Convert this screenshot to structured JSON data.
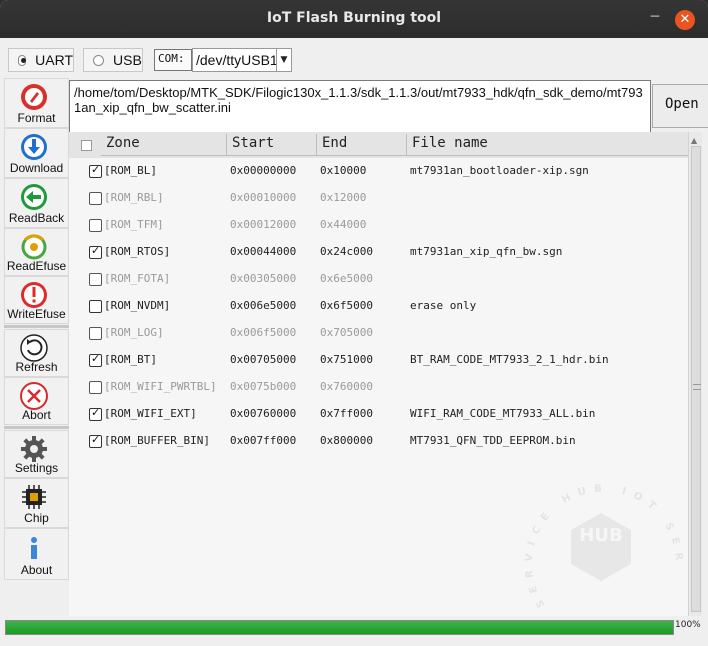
{
  "window": {
    "title": "IoT Flash Burning tool"
  },
  "connection": {
    "uart_label": "UART",
    "usb_label": "USB",
    "selected": "UART",
    "com_label": "COM:",
    "com_value": "/dev/ttyUSB1"
  },
  "sidebar": {
    "items": [
      {
        "label": "Format",
        "icon": "format-icon"
      },
      {
        "label": "Download",
        "icon": "download-icon"
      },
      {
        "label": "ReadBack",
        "icon": "readback-icon"
      },
      {
        "label": "ReadEfuse",
        "icon": "read-efuse-icon"
      },
      {
        "label": "WriteEfuse",
        "icon": "write-efuse-icon"
      },
      {
        "label": "Refresh",
        "icon": "refresh-icon"
      },
      {
        "label": "Abort",
        "icon": "abort-icon"
      },
      {
        "label": "Settings",
        "icon": "gear-icon"
      },
      {
        "label": "Chip",
        "icon": "chip-icon"
      },
      {
        "label": "About",
        "icon": "info-icon"
      }
    ]
  },
  "file": {
    "path": "/home/tom/Desktop/MTK_SDK/Filogic130x_1.1.3/sdk_1.1.3/out/mt7933_hdk/qfn_sdk_demo/mt7931an_xip_qfn_bw_scatter.ini",
    "open_label": "Open"
  },
  "table": {
    "headers": [
      "Zone",
      "Start",
      "End",
      "File name"
    ],
    "rows": [
      {
        "zone": "[ROM_BL]",
        "start": "0x00000000",
        "end": "0x10000",
        "file": "mt7931an_bootloader-xip.sgn",
        "checked": true,
        "enabled": true
      },
      {
        "zone": "[ROM_RBL]",
        "start": "0x00010000",
        "end": "0x12000",
        "file": "",
        "checked": false,
        "enabled": false
      },
      {
        "zone": "[ROM_TFM]",
        "start": "0x00012000",
        "end": "0x44000",
        "file": "",
        "checked": false,
        "enabled": false
      },
      {
        "zone": "[ROM_RTOS]",
        "start": "0x00044000",
        "end": "0x24c000",
        "file": "mt7931an_xip_qfn_bw.sgn",
        "checked": true,
        "enabled": true
      },
      {
        "zone": "[ROM_FOTA]",
        "start": "0x00305000",
        "end": "0x6e5000",
        "file": "",
        "checked": false,
        "enabled": false
      },
      {
        "zone": "[ROM_NVDM]",
        "start": "0x006e5000",
        "end": "0x6f5000",
        "file": "erase only",
        "checked": false,
        "enabled": true
      },
      {
        "zone": "[ROM_LOG]",
        "start": "0x006f5000",
        "end": "0x705000",
        "file": "",
        "checked": false,
        "enabled": false
      },
      {
        "zone": "[ROM_BT]",
        "start": "0x00705000",
        "end": "0x751000",
        "file": "BT_RAM_CODE_MT7933_2_1_hdr.bin",
        "checked": true,
        "enabled": true
      },
      {
        "zone": "[ROM_WIFI_PWRTBL]",
        "start": "0x0075b000",
        "end": "0x760000",
        "file": "",
        "checked": false,
        "enabled": false
      },
      {
        "zone": "[ROM_WIFI_EXT]",
        "start": "0x00760000",
        "end": "0x7ff000",
        "file": "WIFI_RAM_CODE_MT7933_ALL.bin",
        "checked": true,
        "enabled": true
      },
      {
        "zone": "[ROM_BUFFER_BIN]",
        "start": "0x007ff000",
        "end": "0x800000",
        "file": "MT7931_QFN_TDD_EEPROM.bin",
        "checked": true,
        "enabled": true
      }
    ]
  },
  "progress": {
    "value": 1.0,
    "label": "100%"
  },
  "watermark": {
    "text": "SERVICE HUB IOT SERVICE",
    "letters": "HUB"
  },
  "colors": {
    "accent": "#e95420",
    "progress": "#22a52f",
    "link_blue": "#1f6fd0"
  }
}
